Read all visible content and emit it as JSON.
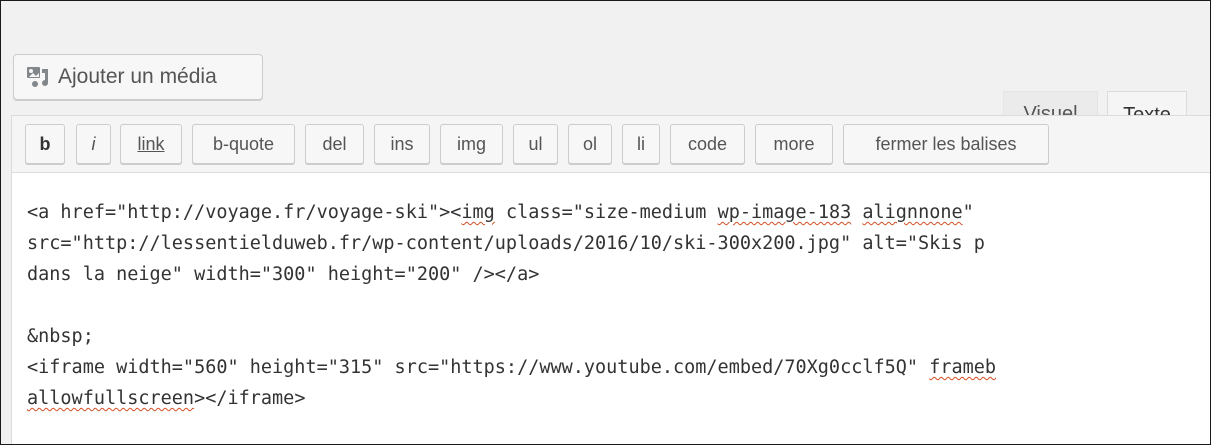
{
  "media_button": {
    "label": "Ajouter un média",
    "icon": "add-media-icon"
  },
  "tabs": [
    {
      "label": "Visuel",
      "active": false
    },
    {
      "label": "Texte",
      "active": true
    }
  ],
  "toolbar": {
    "buttons": [
      "b",
      "i",
      "link",
      "b-quote",
      "del",
      "ins",
      "img",
      "ul",
      "ol",
      "li",
      "code",
      "more",
      "fermer les balises"
    ]
  },
  "editor": {
    "line1a": "<a href=\"http://voyage.fr/voyage-ski\"><",
    "line1b": "img",
    "line1c": " class=\"size-medium ",
    "line1d": "wp-image-183",
    "line1e": " ",
    "line1f": "alignnone",
    "line1g": "\"",
    "line2": "src=\"http://lessentielduweb.fr/wp-content/uploads/2016/10/ski-300x200.jpg\" alt=\"Skis p",
    "line3": "dans la neige\" width=\"300\" height=\"200\" /></a>",
    "line4": "",
    "line5": "&nbsp;",
    "line6a": "<iframe width=\"560\" height=\"315\" src=\"https://www.youtube.com/embed/70Xg0cclf5Q\" ",
    "line6b": "frameb",
    "line7a": "allowfullscreen",
    "line7b": "></iframe>"
  }
}
